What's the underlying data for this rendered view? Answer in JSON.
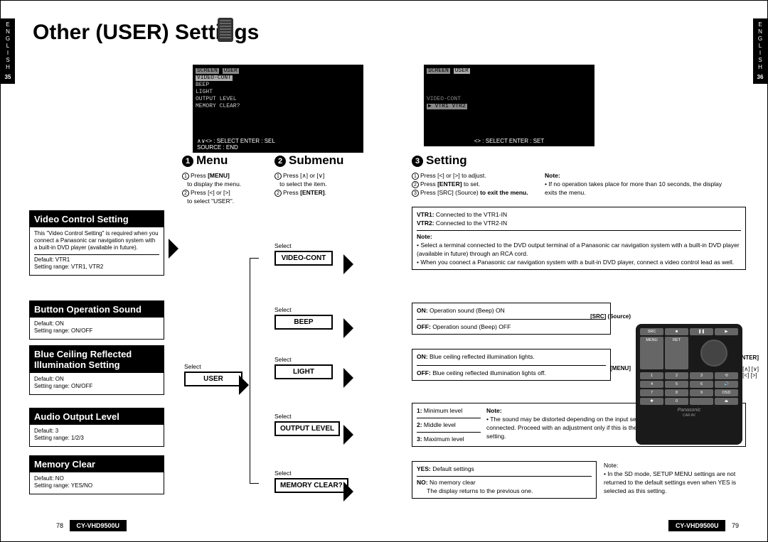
{
  "side": {
    "lang": "E\nN\nG\nL\nI\nS\nH",
    "left_num": "35",
    "right_num": "36"
  },
  "title": "Other (USER) Settings",
  "osd1": {
    "line1": "SCREEN",
    "line1b": "USER",
    "items": [
      "VIDEO-CONT",
      "BEEP",
      "LIGHT",
      "OUTPUT LEVEL",
      "MEMORY CLEAR?"
    ],
    "caption": "∧∨<> : SELECT    ENTER : SEL\nSOURCE : END"
  },
  "osd2": {
    "line1": "SCREEN",
    "line1b": "USER",
    "sub": "VIDEO-CONT",
    "opts": "▶ VTR1     VTR2",
    "caption": "<> : SELECT    ENTER : SET"
  },
  "steps": {
    "s1": {
      "title": "Menu",
      "l1": "Press [MENU]",
      "l2": "to display the menu.",
      "l3": "Press [<] or [>]",
      "l4": "to select \"USER\"."
    },
    "s2": {
      "title": "Submenu",
      "l1": "Press [∧] or [∨]",
      "l2": "to select the item.",
      "l3": "Press [ENTER]."
    },
    "s3": {
      "title": "Setting",
      "l1": "Press [<] or [>] to adjust.",
      "l2": "Press [ENTER] to set.",
      "l3a": "Press [SRC] (Source) ",
      "l3b": "to exit the menu."
    }
  },
  "note_top": {
    "h": "Note:",
    "t": "If no operation takes place for more than 10 seconds, the display exits the menu."
  },
  "left": {
    "video": {
      "h": "Video Control Setting",
      "b": "This \"Video Control Setting\" is required when you connect a Panasonic car navigation system with a built-in DVD player (available in future).",
      "d": "Default: VTR1",
      "r": "Setting range: VTR1, VTR2"
    },
    "beep": {
      "h": "Button Operation Sound",
      "d": "Default: ON",
      "r": "Setting range: ON/OFF"
    },
    "light": {
      "h1": "Blue Ceiling Reflected",
      "h2": "Illumination Setting",
      "d": "Default: ON",
      "r": "Setting range: ON/OFF"
    },
    "out": {
      "h": "Audio Output Level",
      "d": "Default: 3",
      "r": "Setting range: 1/2/3"
    },
    "mc": {
      "h": "Memory Clear",
      "d": "Default: NO",
      "r": "Setting range: YES/NO"
    }
  },
  "sel": {
    "select": "Select",
    "user": "USER",
    "video": "VIDEO-CONT",
    "beep": "BEEP",
    "light": "LIGHT",
    "out": "OUTPUT LEVEL",
    "mc": "MEMORY CLEAR?"
  },
  "expl": {
    "video": {
      "v1": "VTR1:",
      "v1t": " Connected to the VTR1-IN",
      "v2": "VTR2:",
      "v2t": " Connected to the VTR2-IN",
      "nh": "Note:",
      "b1": "Select a terminal connected to the DVD output terminal of  a Panasonic car navigation system with a built-in DVD player (available in future) through an RCA cord.",
      "b2": "When you coonect a Panasonic car navigation system with a buit-in DVD player, connect a video control lead as well."
    },
    "beep": {
      "on": "ON:",
      "ont": "  Operation sound (Beep) ON",
      "off": "OFF:",
      "offt": " Operation sound (Beep) OFF"
    },
    "light": {
      "on": "ON:",
      "ont": "  Blue ceiling reflected  illumination lights.",
      "off": "OFF:",
      "offt": " Blue ceiling reflected  illumination lights off."
    },
    "out": {
      "l1": "1:",
      "l1t": " Minimum level",
      "l2": "2:",
      "l2t": " Middle level",
      "l3": "3:",
      "l3t": " Maximum level",
      "nh": "Note:",
      "nt": "The sound may be distorted depending on the input sensitivity of the external device connected. Proceed with an adjustment only if this is the case. Normally, keep at the default setting."
    },
    "mc": {
      "y": "YES:",
      "yt": " Default settings",
      "n": "NO:",
      "nt": "  No memory clear",
      "sub": "The display returns to the previous one."
    },
    "mc2": {
      "nh": "Note:",
      "t": "In the SD mode, SETUP MENU settings are not returned to the default settings even when YES is selected as this setting."
    }
  },
  "remote_labels": {
    "src": "[SRC] (Source)",
    "menu": "[MENU]",
    "enter": "[ENTER]",
    "arrows": "[∧] [∨]\n[<] [>]"
  },
  "remote": {
    "brand": "Panasonic",
    "sub": "CAR AV",
    "top": [
      "SRC",
      "■",
      "❚❚",
      "▶"
    ],
    "top2": [
      "MENU",
      "RET",
      "",
      ""
    ],
    "nums": [
      "1",
      "2",
      "3",
      "⟲",
      "4",
      "5",
      "6",
      "🔊",
      "7",
      "8",
      "9",
      "OSD",
      "✱",
      "0",
      "",
      "⏏"
    ]
  },
  "foot": {
    "p_left": "78",
    "p_right": "79",
    "model": "CY-VHD9500U"
  }
}
